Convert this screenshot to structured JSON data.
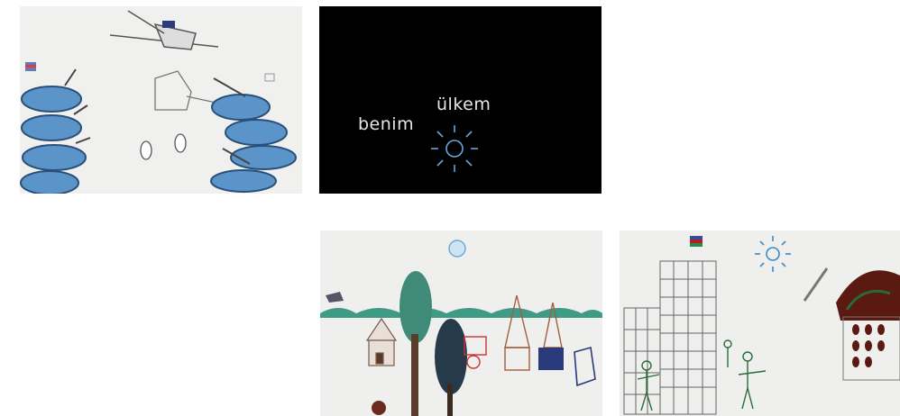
{
  "frames": [
    {
      "id": "tanks",
      "description_icon": "tanks-and-helicopter-drawing"
    },
    {
      "id": "title",
      "words": [
        "benim",
        "ülkem"
      ],
      "description_icon": "sun-icon"
    },
    {
      "id": "town",
      "description_icon": "village-drawing"
    },
    {
      "id": "city",
      "description_icon": "city-under-attack-drawing"
    }
  ],
  "colors": {
    "tank_blue": "#5a94c8",
    "title_bg": "#000000",
    "sun_blue": "#6aa6d8",
    "hill_green": "#3f9a86",
    "flag_red": "#b02222",
    "tree_dark": "#263a4a"
  }
}
